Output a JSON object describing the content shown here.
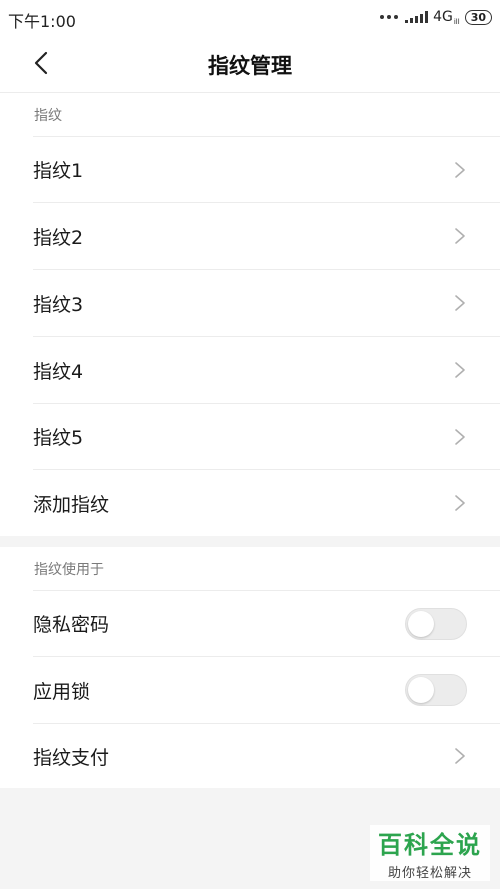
{
  "status_bar": {
    "time": "下午1:00",
    "network": "4G",
    "network_sub": "ill",
    "battery": "30"
  },
  "header": {
    "back_icon": "chevron-left-icon",
    "title": "指纹管理"
  },
  "fingerprints_section": {
    "label": "指纹",
    "items": [
      {
        "label": "指纹1",
        "control": "chevron"
      },
      {
        "label": "指纹2",
        "control": "chevron"
      },
      {
        "label": "指纹3",
        "control": "chevron"
      },
      {
        "label": "指纹4",
        "control": "chevron"
      },
      {
        "label": "指纹5",
        "control": "chevron"
      },
      {
        "label": "添加指纹",
        "control": "chevron"
      }
    ]
  },
  "usage_section": {
    "label": "指纹使用于",
    "items": [
      {
        "label": "隐私密码",
        "control": "toggle",
        "on": false
      },
      {
        "label": "应用锁",
        "control": "toggle",
        "on": false
      },
      {
        "label": "指纹支付",
        "control": "chevron"
      }
    ]
  },
  "watermark": {
    "title": "百科全说",
    "subtitle": "助你轻松解决"
  },
  "colors": {
    "background": "#f4f4f4",
    "card": "#ffffff",
    "divider": "#ececec",
    "watermark_green": "#2ca44e"
  }
}
